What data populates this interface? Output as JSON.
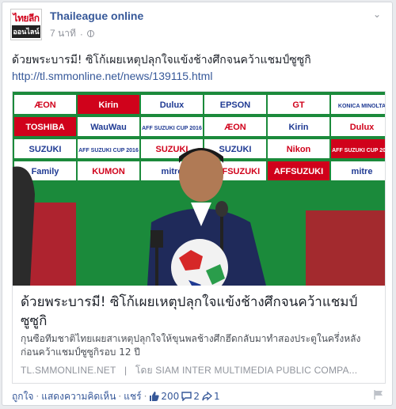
{
  "post": {
    "page_name": "Thaileague online",
    "avatar_top": "ไทยลีก",
    "avatar_bottom": "ออนไลน์",
    "time": "7 นาที",
    "separator": "·",
    "text": "ด้วยพระบารมี! ซิโก้เผยเหตุปลุกใจแข้งช้างศึกจนคว้าแชมป์ซูซูกิ",
    "link": "http://tl.smmonline.net/news/139115.html"
  },
  "attachment": {
    "title": "ด้วยพระบารมี! ซิโก้เผยเหตุปลุกใจแข้งช้างศึกจนคว้าแชมป์ซูซูกิ",
    "description": "กุนซือทีมชาติไทยเผยสาเหตุปลุกใจให้ขุนพลช้างศึกฮึดกลับมาทำสองประตูในครึ่งหลัง ก่อนคว้าแชมป์ซูซูกิรอบ 12 ปี",
    "domain": "TL.SMMONLINE.NET",
    "footer_sep": "|",
    "by": "โดย SIAM INTER MULTIMEDIA PUBLIC COMPA...",
    "backdrop_logos": [
      "ÆON",
      "Kirin",
      "Dulux",
      "EPSON",
      "GT",
      "KONICA MINOLTA",
      "TOSHIBA",
      "WauWau",
      "AFF SUZUKI CUP 2016",
      "ÆON",
      "Kirin",
      "Dulux",
      "SUZUKI",
      "AFF SUZUKI CUP 2016",
      "SUZUKI",
      "SUZUKI",
      "Nikon",
      "AFF SUZUKI CUP 2016",
      "Family",
      "KUMON",
      "mitre",
      "AFFSUZUKI",
      "AFFSUZUKI",
      "mitre"
    ]
  },
  "actions": {
    "like": "ถูกใจ",
    "comment": "แสดงความคิดเห็น",
    "share": "แชร์",
    "dot": "·",
    "likes": "200",
    "comments": "2",
    "shares": "1"
  },
  "colors": {
    "link": "#365899",
    "backdrop_green": "#1b8a3b",
    "muted": "#90949c"
  }
}
